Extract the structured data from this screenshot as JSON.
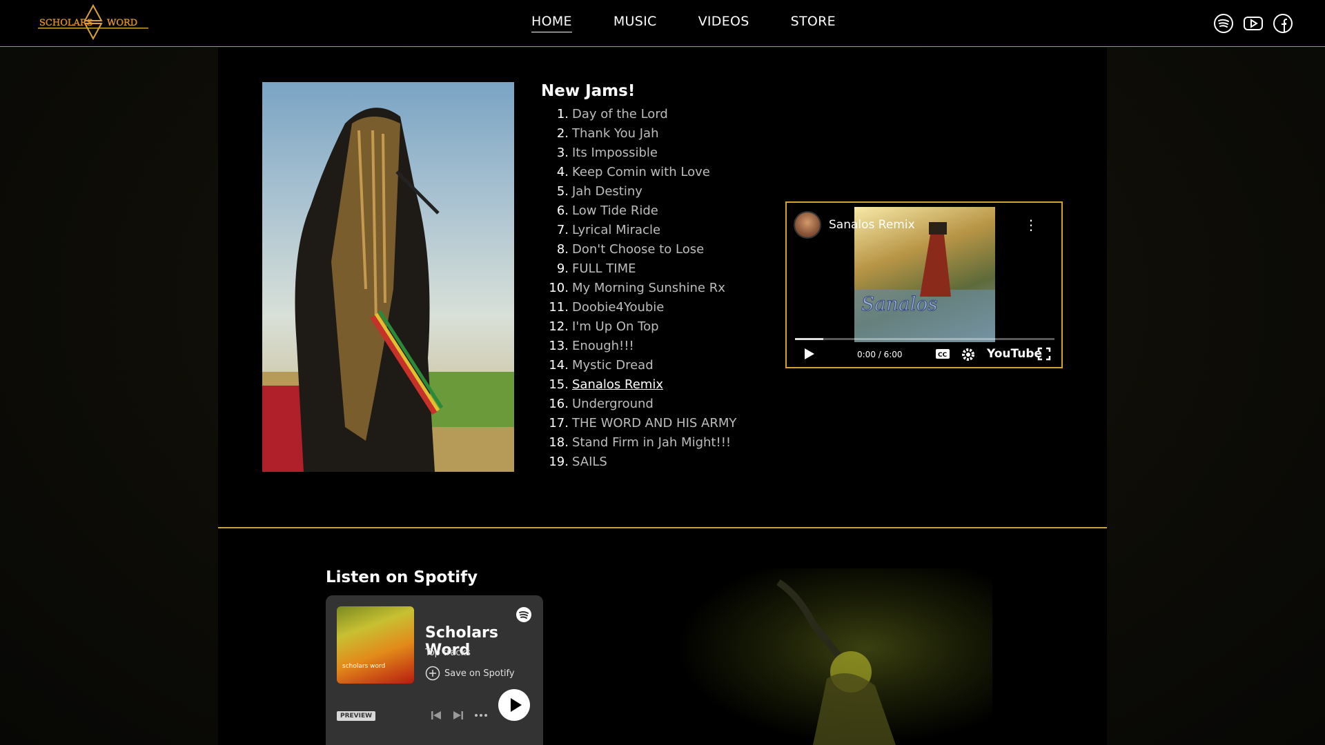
{
  "header": {
    "logo_text": "Scholars Word",
    "nav": [
      {
        "label": "HOME",
        "active": true
      },
      {
        "label": "MUSIC",
        "active": false
      },
      {
        "label": "VIDEOS",
        "active": false
      },
      {
        "label": "STORE",
        "active": false
      }
    ],
    "social_icons": [
      "spotify-icon",
      "youtube-icon",
      "facebook-icon"
    ]
  },
  "jams": {
    "title": "New Jams!",
    "tracks": [
      {
        "num": "1.",
        "name": "Day of the Lord"
      },
      {
        "num": "2.",
        "name": "Thank You Jah"
      },
      {
        "num": "3.",
        "name": "Its Impossible"
      },
      {
        "num": "4.",
        "name": "Keep Comin with Love"
      },
      {
        "num": "5.",
        "name": "Jah Destiny"
      },
      {
        "num": "6.",
        "name": "Low Tide Ride"
      },
      {
        "num": "7.",
        "name": "Lyrical Miracle"
      },
      {
        "num": "8.",
        "name": "Don't Choose to Lose"
      },
      {
        "num": "9.",
        "name": "FULL TIME"
      },
      {
        "num": "10.",
        "name": "My Morning Sunshine Rx"
      },
      {
        "num": "11.",
        "name": "Doobie4Youbie"
      },
      {
        "num": "12.",
        "name": "I'm Up On Top"
      },
      {
        "num": "13.",
        "name": "Enough!!!"
      },
      {
        "num": "14.",
        "name": "Mystic Dread"
      },
      {
        "num": "15.",
        "name": "Sanalos Remix"
      },
      {
        "num": "16.",
        "name": "Underground"
      },
      {
        "num": "17.",
        "name": "THE WORD AND HIS ARMY"
      },
      {
        "num": "18.",
        "name": "Stand Firm in Jah Might!!!"
      },
      {
        "num": "19.",
        "name": "SAILS"
      }
    ],
    "current_track_index": 14
  },
  "video": {
    "title": "Sanalos Remix",
    "time": "0:00 / 6:00",
    "brand": "YouTube",
    "thumbnail_text": "Sanalos",
    "progress_fraction": 0.11
  },
  "spotify": {
    "section_title": "Listen on Spotify",
    "artist": "Scholars Word",
    "subtitle": "Top tracks",
    "save_label": "Save on Spotify",
    "preview_label": "PREVIEW",
    "cover_text": "scholars word"
  },
  "colors": {
    "accent_gold": "#c9a43a",
    "header_bg": "#000000",
    "spotify_card": "#333333"
  }
}
